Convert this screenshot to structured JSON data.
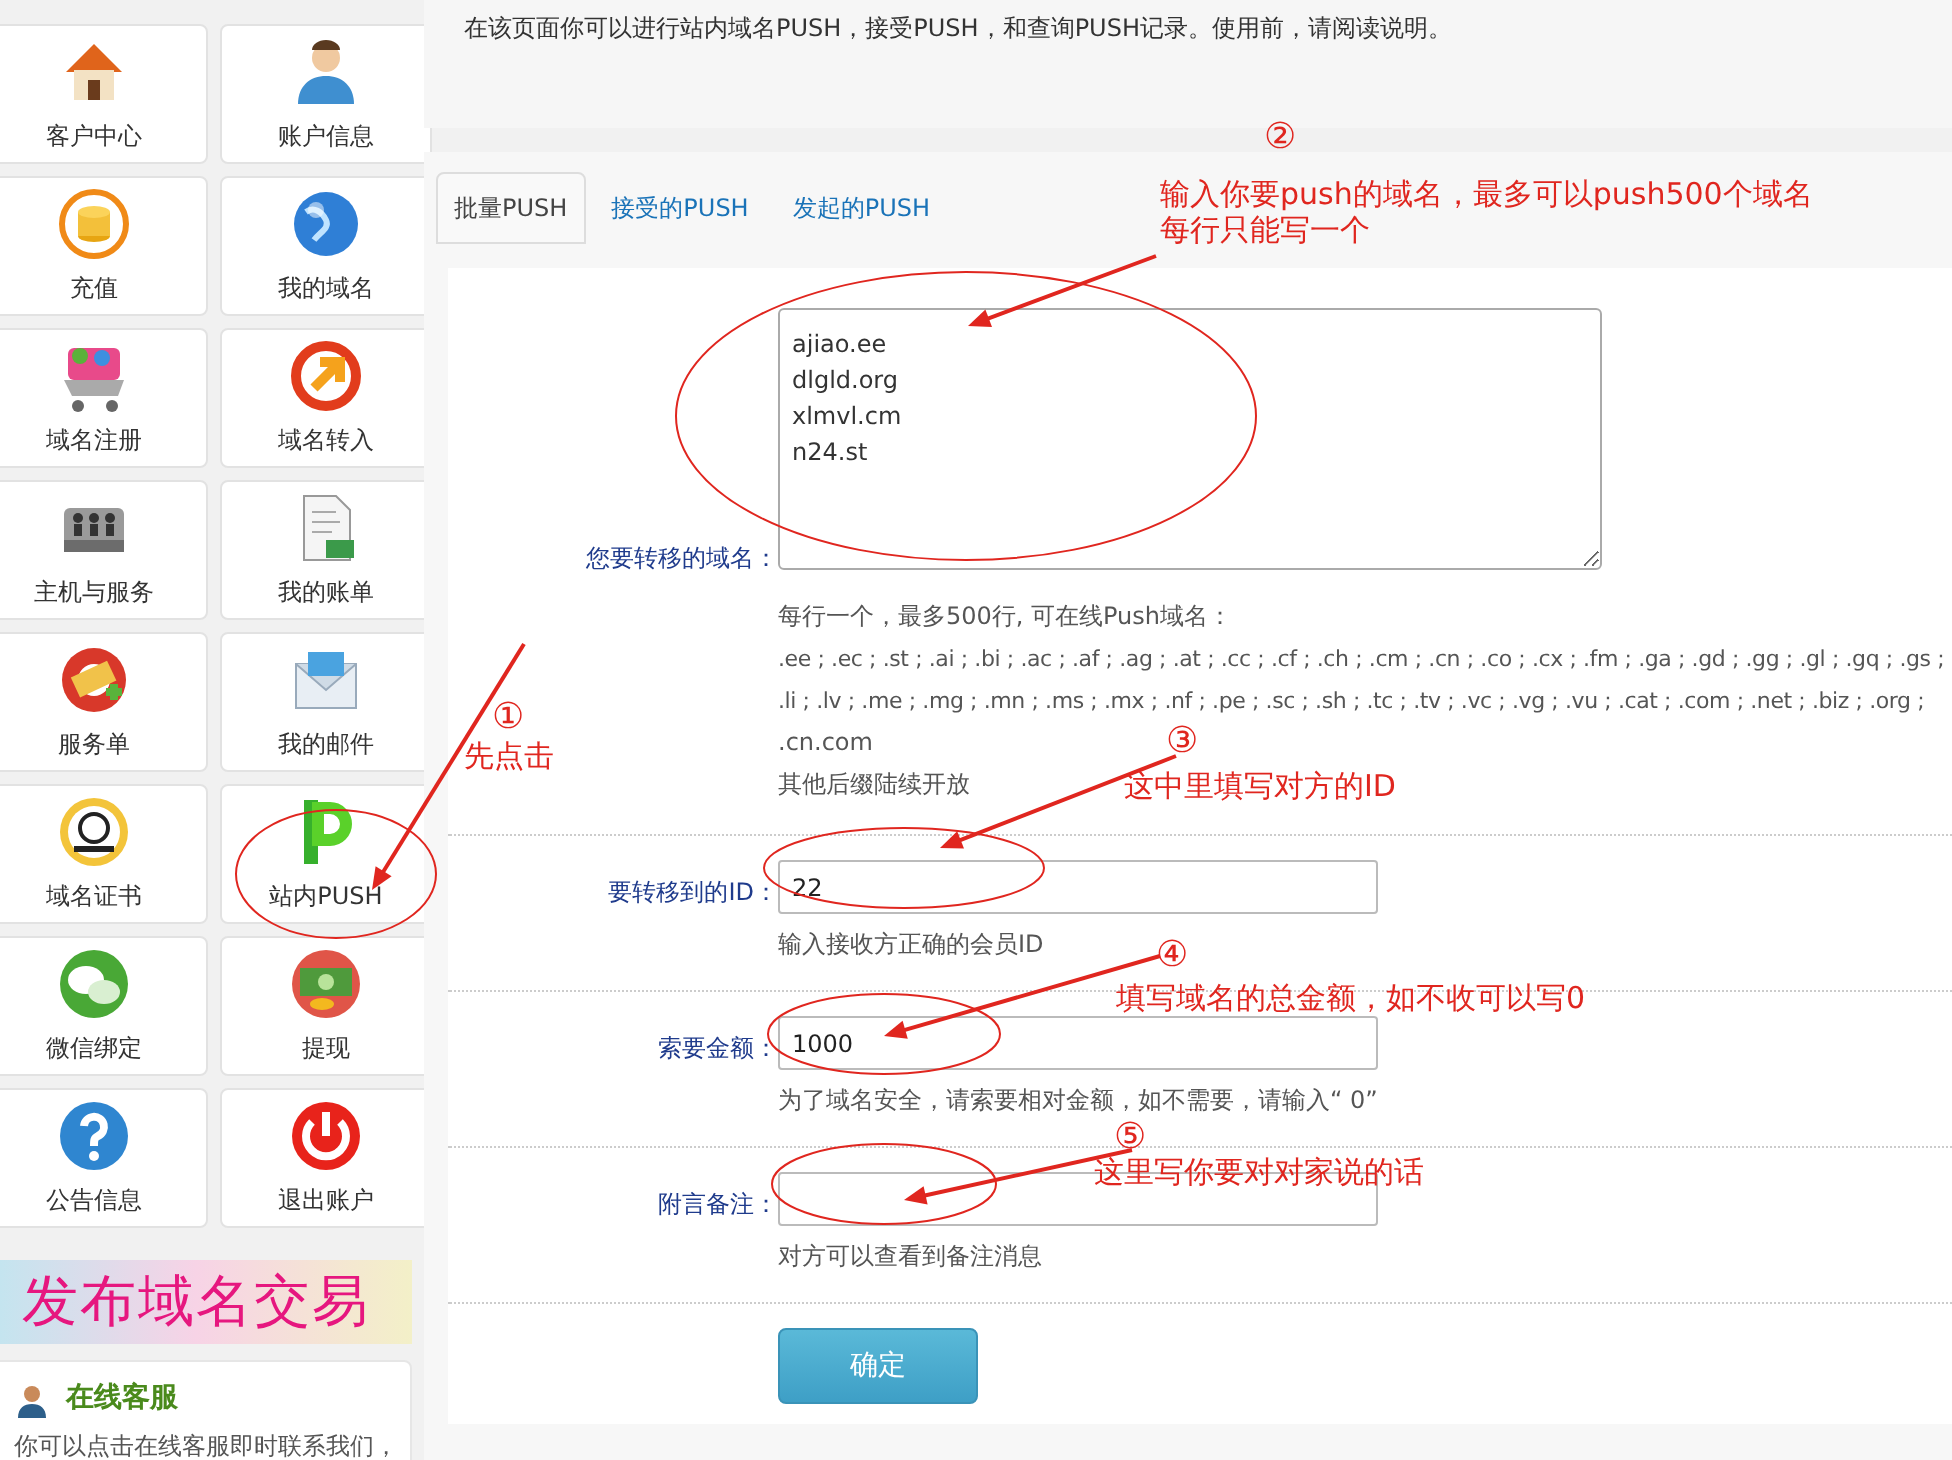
{
  "sidebar": {
    "tiles": [
      {
        "label": "客户中心"
      },
      {
        "label": "账户信息"
      },
      {
        "label": "充值"
      },
      {
        "label": "我的域名"
      },
      {
        "label": "域名注册"
      },
      {
        "label": "域名转入"
      },
      {
        "label": "主机与服务"
      },
      {
        "label": "我的账单"
      },
      {
        "label": "服务单"
      },
      {
        "label": "我的邮件"
      },
      {
        "label": "域名证书"
      },
      {
        "label": "站内PUSH"
      },
      {
        "label": "微信绑定"
      },
      {
        "label": "提现"
      },
      {
        "label": "公告信息"
      },
      {
        "label": "退出账户"
      }
    ],
    "banner": "发布域名交易",
    "service": {
      "title": "在线客服",
      "text": "你可以点击在线客服即时联系我们，"
    }
  },
  "intro": "在该页面你可以进行站内域名PUSH，接受PUSH，和查询PUSH记录。使用前，请阅读说明。",
  "tabs": [
    {
      "label": "批量PUSH",
      "selected": true
    },
    {
      "label": "接受的PUSH",
      "selected": false
    },
    {
      "label": "发起的PUSH",
      "selected": false
    }
  ],
  "form": {
    "domains": {
      "label": "您要转移的域名：",
      "value": "ajiao.ee\ndlgld.org\nxlmvl.cm\nn24.st",
      "help": [
        "每行一个，最多500行, 可在线Push域名：",
        ".ee ; .ec ; .st ; .ai ; .bi ; .ac ; .af ; .ag ; .at ; .cc ; .cf ; .ch ; .cm ; .cn ; .co ; .cx ; .fm ; .ga ; .gd ; .gg ; .gl ; .gq ; .gs ;",
        ".li ; .lv ; .me ; .mg ; .mn ; .ms ; .mx ; .nf ; .pe ; .sc ; .sh ; .tc ; .tv ; .vc ; .vg ; .vu ; .cat ; .com ; .net ; .biz ; .org ;",
        ".cn.com",
        "其他后缀陆续开放"
      ]
    },
    "fields": [
      {
        "label": "要转移到的ID：",
        "value": "22",
        "help": "输入接收方正确的会员ID"
      },
      {
        "label": "索要金额：",
        "value": "1000",
        "help": "为了域名安全，请索要相对金额，如不需要，请输入“ 0”"
      },
      {
        "label": "附言备注：",
        "help": "对方可以查看到备注消息"
      }
    ],
    "submit": "确定"
  },
  "annotations": [
    {
      "number": "①",
      "lines": [
        "先点击"
      ]
    },
    {
      "number": "②",
      "lines": [
        "输入你要push的域名，最多可以push500个域名",
        "每行只能写一个"
      ]
    },
    {
      "number": "③",
      "lines": [
        "这中里填写对方的ID"
      ]
    },
    {
      "number": "④",
      "lines": [
        "填写域名的总金额，如不收可以写0"
      ]
    },
    {
      "number": "⑤",
      "lines": [
        "这里写你要对对家说的话"
      ]
    }
  ]
}
